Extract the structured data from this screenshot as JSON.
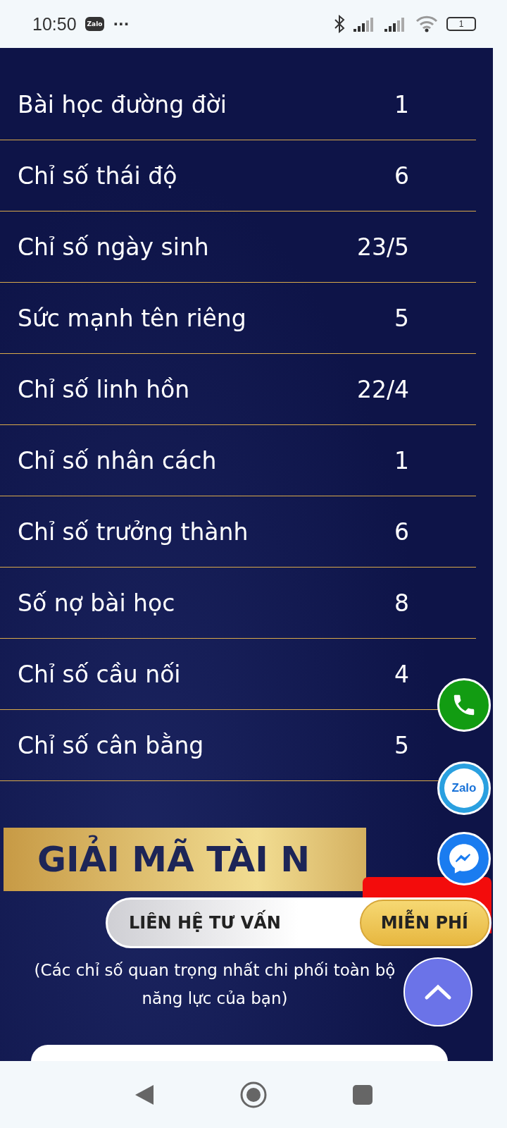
{
  "status_bar": {
    "time": "10:50",
    "app_badge": "Zalo",
    "more": "···",
    "battery": "1"
  },
  "rows": [
    {
      "label": "Bài học đường đời",
      "value": "1"
    },
    {
      "label": "Chỉ số thái độ",
      "value": "6"
    },
    {
      "label": "Chỉ số ngày sinh",
      "value": "23/5"
    },
    {
      "label": "Sức mạnh tên riêng",
      "value": "5"
    },
    {
      "label": "Chỉ số linh hồn",
      "value": "22/4"
    },
    {
      "label": "Chỉ số nhân cách",
      "value": "1"
    },
    {
      "label": "Chỉ số trưởng thành",
      "value": "6"
    },
    {
      "label": "Số nợ bài học",
      "value": "8"
    },
    {
      "label": "Chỉ số cầu nối",
      "value": "4"
    },
    {
      "label": "Chỉ số cân bằng",
      "value": "5"
    }
  ],
  "section": {
    "heading": "GIẢI MÃ TÀI N",
    "subtitle": "(Các chỉ số quan trọng nhất chi phối toàn bộ năng lực của bạn)"
  },
  "contact_button": {
    "label": "LIÊN HỆ TƯ VẤN",
    "badge": "MIỄN PHÍ"
  },
  "floating": {
    "zalo_label": "Zalo"
  }
}
